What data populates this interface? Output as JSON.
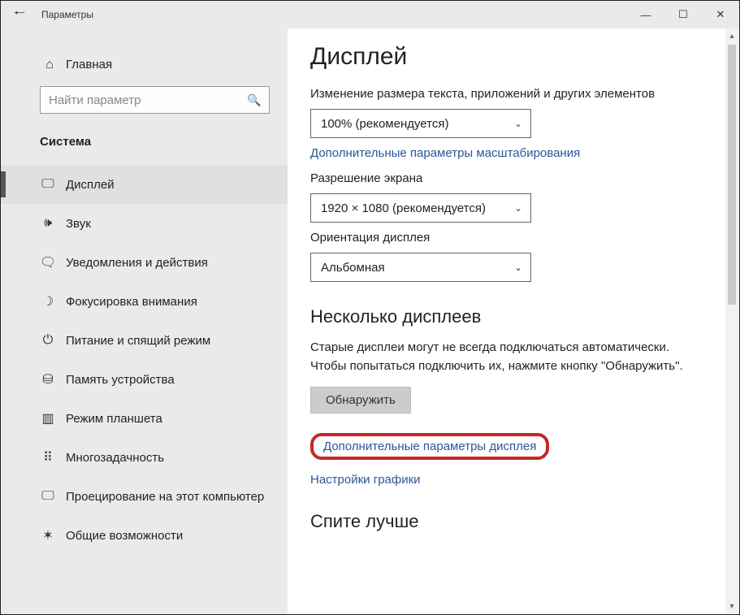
{
  "window": {
    "title": "Параметры"
  },
  "sidebar": {
    "home": "Главная",
    "search_placeholder": "Найти параметр",
    "category": "Система",
    "items": [
      {
        "label": "Дисплей",
        "icon": "display-icon",
        "glyph": "🖵",
        "active": true
      },
      {
        "label": "Звук",
        "icon": "sound-icon",
        "glyph": "🕪",
        "active": false
      },
      {
        "label": "Уведомления и действия",
        "icon": "notifications-icon",
        "glyph": "🗨",
        "active": false
      },
      {
        "label": "Фокусировка внимания",
        "icon": "focus-assist-icon",
        "glyph": "☽",
        "active": false
      },
      {
        "label": "Питание и спящий режим",
        "icon": "power-sleep-icon",
        "glyph": "⏻",
        "active": false
      },
      {
        "label": "Память устройства",
        "icon": "storage-icon",
        "glyph": "⛁",
        "active": false
      },
      {
        "label": "Режим планшета",
        "icon": "tablet-mode-icon",
        "glyph": "▥",
        "active": false
      },
      {
        "label": "Многозадачность",
        "icon": "multitasking-icon",
        "glyph": "⠿",
        "active": false
      },
      {
        "label": "Проецирование на этот компьютер",
        "icon": "projecting-icon",
        "glyph": "🖵",
        "active": false
      },
      {
        "label": "Общие возможности",
        "icon": "shared-experiences-icon",
        "glyph": "✶",
        "active": false
      }
    ]
  },
  "content": {
    "heading": "Дисплей",
    "scale_label": "Изменение размера текста, приложений и других элементов",
    "scale_value": "100% (рекомендуется)",
    "advanced_scaling_link": "Дополнительные параметры масштабирования",
    "resolution_label": "Разрешение экрана",
    "resolution_value": "1920 × 1080 (рекомендуется)",
    "orientation_label": "Ориентация дисплея",
    "orientation_value": "Альбомная",
    "multi_heading": "Несколько дисплеев",
    "multi_desc": "Старые дисплеи могут не всегда подключаться автоматически. Чтобы попытаться подключить их, нажмите кнопку \"Обнаружить\".",
    "detect_button": "Обнаружить",
    "advanced_display_link": "Дополнительные параметры дисплея",
    "graphics_link": "Настройки графики",
    "sleep_heading": "Спите лучше"
  }
}
